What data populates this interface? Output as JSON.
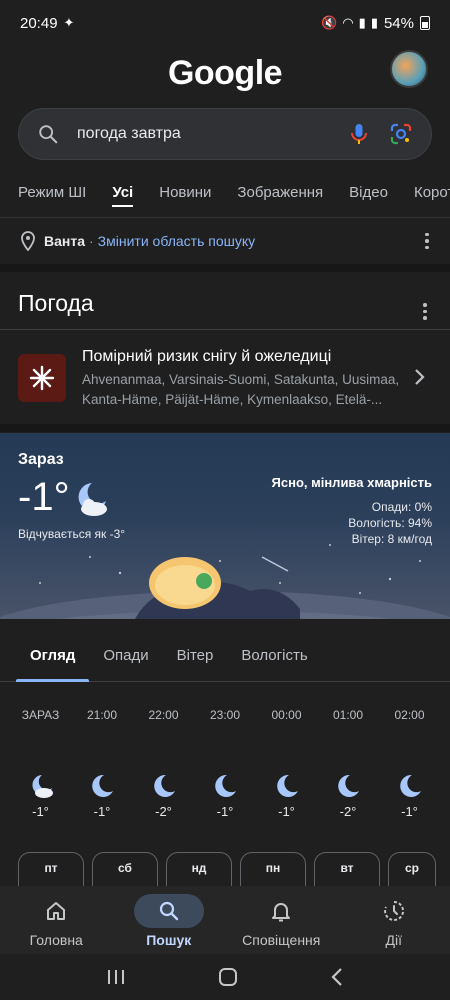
{
  "status_bar": {
    "time": "20:49",
    "battery": "54%"
  },
  "header": {
    "logo_text": "Google"
  },
  "search": {
    "query": "погода завтра"
  },
  "tabs": [
    {
      "label": "Режим ШІ"
    },
    {
      "label": "Усі"
    },
    {
      "label": "Новини"
    },
    {
      "label": "Зображення"
    },
    {
      "label": "Відео"
    },
    {
      "label": "Короткі"
    }
  ],
  "location": {
    "name": "Ванта",
    "separator": "·",
    "change_link": "Змінити область пошуку"
  },
  "weather": {
    "title": "Погода",
    "alert": {
      "title": "Помірний ризик снігу й ожеледиці",
      "regions": "Ahvenanmaa, Varsinais-Suomi, Satakunta, Uusimaa, Kanta-Häme, Päijät-Häme, Kymenlaakso, Etelä-..."
    },
    "current": {
      "label": "Зараз",
      "temp": "-1°",
      "feels_like": "Відчувається як -3°",
      "condition": "Ясно, мінлива хмарність",
      "precip": "Опади: 0%",
      "humidity": "Вологість: 94%",
      "wind": "Вітер: 8 км/год"
    },
    "subtabs": [
      {
        "label": "Огляд"
      },
      {
        "label": "Опади"
      },
      {
        "label": "Вітер"
      },
      {
        "label": "Вологість"
      }
    ],
    "hourly": [
      {
        "time": "ЗАРАЗ",
        "temp": "-1°",
        "icon": "moon-cloud-icon"
      },
      {
        "time": "21:00",
        "temp": "-1°",
        "icon": "moon-icon"
      },
      {
        "time": "22:00",
        "temp": "-2°",
        "icon": "moon-icon"
      },
      {
        "time": "23:00",
        "temp": "-1°",
        "icon": "moon-icon"
      },
      {
        "time": "00:00",
        "temp": "-1°",
        "icon": "moon-icon"
      },
      {
        "time": "01:00",
        "temp": "-2°",
        "icon": "moon-icon"
      },
      {
        "time": "02:00",
        "temp": "-1°",
        "icon": "moon-icon"
      }
    ],
    "days": [
      {
        "label": "пт"
      },
      {
        "label": "сб"
      },
      {
        "label": "нд"
      },
      {
        "label": "пн"
      },
      {
        "label": "вт"
      },
      {
        "label": "ср"
      }
    ]
  },
  "bottom_nav": [
    {
      "label": "Головна",
      "icon": "home-icon"
    },
    {
      "label": "Пошук",
      "icon": "search-icon"
    },
    {
      "label": "Сповіщення",
      "icon": "bell-icon"
    },
    {
      "label": "Дії",
      "icon": "activity-icon"
    }
  ],
  "colors": {
    "background": "#1f1f1f",
    "accent": "#8ab4f8",
    "alert_bg": "#5c1a14"
  }
}
